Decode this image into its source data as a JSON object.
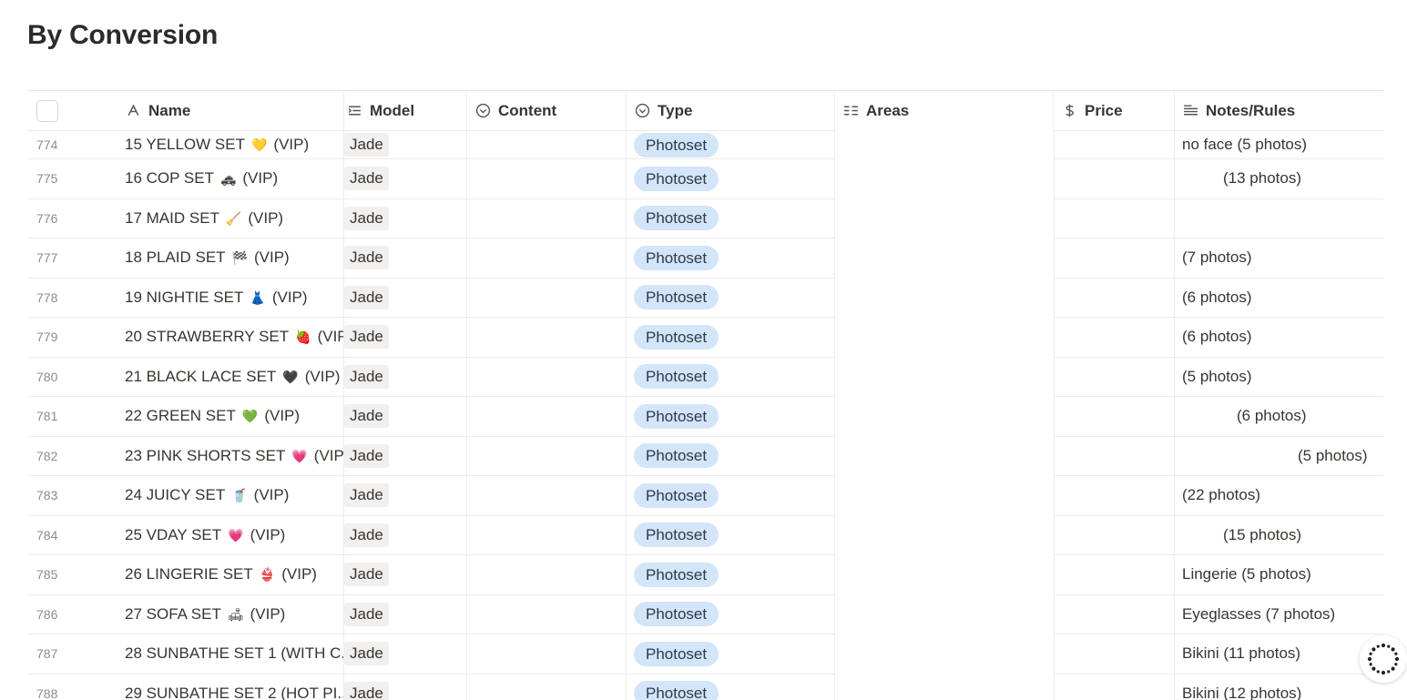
{
  "page": {
    "title": "By Conversion"
  },
  "columns": {
    "name": "Name",
    "model": "Model",
    "content": "Content",
    "type": "Type",
    "areas": "Areas",
    "price": "Price",
    "notes": "Notes/Rules"
  },
  "rows": [
    {
      "num": "774",
      "name": "15 YELLOW SET",
      "emoji": "💛",
      "vip": "(VIP)",
      "model": "Jade",
      "type": "Photoset",
      "notes": "no face (5 photos)",
      "notes_indent": 0
    },
    {
      "num": "775",
      "name": "16 COP SET",
      "emoji": "🚓",
      "vip": "(VIP)",
      "model": "Jade",
      "type": "Photoset",
      "notes": "(13 photos)",
      "notes_indent": 45
    },
    {
      "num": "776",
      "name": "17 MAID SET",
      "emoji": "🧹",
      "vip": "(VIP)",
      "model": "Jade",
      "type": "Photoset",
      "notes": "",
      "notes_indent": 0
    },
    {
      "num": "777",
      "name": "18 PLAID SET",
      "emoji": "🏁",
      "vip": "(VIP)",
      "model": "Jade",
      "type": "Photoset",
      "notes": "(7 photos)",
      "notes_indent": 0
    },
    {
      "num": "778",
      "name": "19 NIGHTIE SET",
      "emoji": "👗",
      "vip": "(VIP)",
      "model": "Jade",
      "type": "Photoset",
      "notes": "(6 photos)",
      "notes_indent": 0
    },
    {
      "num": "779",
      "name": "20 STRAWBERRY SET",
      "emoji": "🍓",
      "vip": "(VIP)",
      "model": "Jade",
      "type": "Photoset",
      "notes": "(6 photos)",
      "notes_indent": 0
    },
    {
      "num": "780",
      "name": "21 BLACK LACE SET",
      "emoji": "🖤",
      "vip": "(VIP)",
      "model": "Jade",
      "type": "Photoset",
      "notes": "(5 photos)",
      "notes_indent": 0
    },
    {
      "num": "781",
      "name": "22 GREEN SET",
      "emoji": "💚",
      "vip": "(VIP)",
      "model": "Jade",
      "type": "Photoset",
      "notes": "(6 photos)",
      "notes_indent": 60
    },
    {
      "num": "782",
      "name": "23 PINK SHORTS SET",
      "emoji": "💗",
      "vip": "(VIP)",
      "model": "Jade",
      "type": "Photoset",
      "notes": "(5 photos)",
      "notes_indent": 127
    },
    {
      "num": "783",
      "name": "24 JUICY SET",
      "emoji": "🥤",
      "vip": "(VIP)",
      "model": "Jade",
      "type": "Photoset",
      "notes": "(22 photos)",
      "notes_indent": 0
    },
    {
      "num": "784",
      "name": "25 VDAY SET",
      "emoji": "💗",
      "vip": "(VIP)",
      "model": "Jade",
      "type": "Photoset",
      "notes": "(15 photos)",
      "notes_indent": 45
    },
    {
      "num": "785",
      "name": "26 LINGERIE SET",
      "emoji": "👙",
      "vip": "(VIP)",
      "model": "Jade",
      "type": "Photoset",
      "notes": "Lingerie (5 photos)",
      "notes_indent": 0
    },
    {
      "num": "786",
      "name": "27 SOFA SET",
      "emoji": "🛋",
      "vip": "(VIP)",
      "model": "Jade",
      "type": "Photoset",
      "notes": "Eyeglasses (7 photos)",
      "notes_indent": 0
    },
    {
      "num": "787",
      "name": "28 SUNBATHE SET 1 (WITH C...",
      "emoji": "",
      "vip": "",
      "model": "Jade",
      "type": "Photoset",
      "notes": "Bikini (11 photos)",
      "notes_indent": 0
    },
    {
      "num": "788",
      "name": "29 SUNBATHE SET 2 (HOT PI...",
      "emoji": "",
      "vip": "",
      "model": "Jade",
      "type": "Photoset",
      "notes": "Bikini (12 photos)",
      "notes_indent": 0
    }
  ],
  "icons": {
    "name": "text-type-icon",
    "model": "relation-icon",
    "content": "select-icon",
    "type": "select-icon",
    "areas": "multi-select-icon",
    "price": "dollar-icon",
    "notes": "text-lines-icon"
  },
  "colors": {
    "pill_bg": "#d3e5f9",
    "model_tag_bg": "#f1f0ee"
  }
}
